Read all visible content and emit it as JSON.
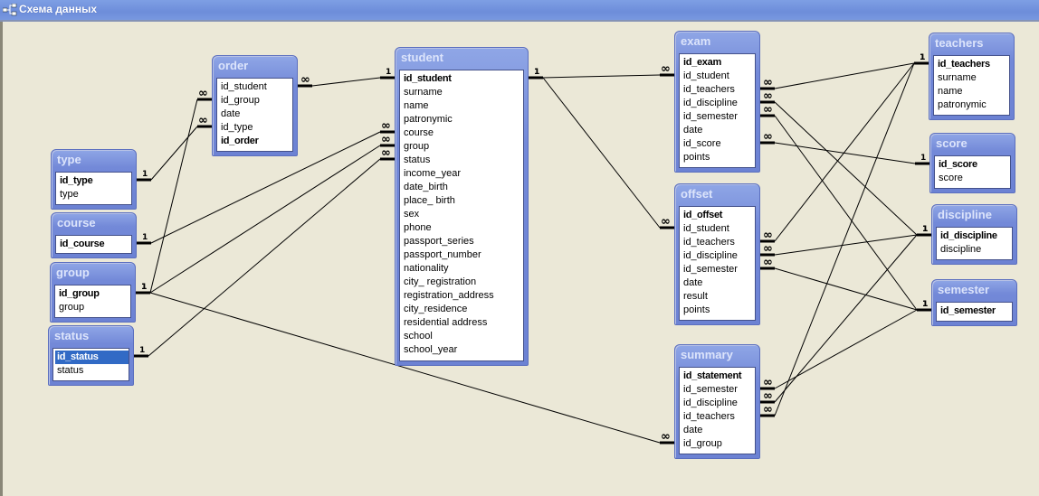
{
  "window": {
    "title": "Схема данных",
    "icon": "relationships-icon"
  },
  "tables": {
    "type": {
      "name": "type",
      "fields": [
        {
          "label": "id_type",
          "key": true
        },
        {
          "label": "type"
        }
      ]
    },
    "course": {
      "name": "course",
      "fields": [
        {
          "label": "id_course",
          "key": true
        }
      ]
    },
    "group": {
      "name": "group",
      "fields": [
        {
          "label": "id_group",
          "key": true
        },
        {
          "label": "group"
        }
      ]
    },
    "status": {
      "name": "status",
      "fields": [
        {
          "label": "id_status",
          "key": true,
          "selected": true
        },
        {
          "label": "status"
        }
      ]
    },
    "order": {
      "name": "order",
      "fields": [
        {
          "label": "id_student"
        },
        {
          "label": "id_group"
        },
        {
          "label": "date"
        },
        {
          "label": "id_type"
        },
        {
          "label": "id_order",
          "key": true
        }
      ]
    },
    "student": {
      "name": "student",
      "fields": [
        {
          "label": "id_student",
          "key": true
        },
        {
          "label": "surname"
        },
        {
          "label": "name"
        },
        {
          "label": "patronymic"
        },
        {
          "label": "course"
        },
        {
          "label": "group"
        },
        {
          "label": "status"
        },
        {
          "label": "income_year"
        },
        {
          "label": "date_birth"
        },
        {
          "label": "place_ birth"
        },
        {
          "label": "sex"
        },
        {
          "label": "phone"
        },
        {
          "label": "passport_series"
        },
        {
          "label": "passport_number"
        },
        {
          "label": "nationality"
        },
        {
          "label": "city_ registration"
        },
        {
          "label": "registration_address"
        },
        {
          "label": "city_residence"
        },
        {
          "label": "residential address"
        },
        {
          "label": "school"
        },
        {
          "label": "school_year"
        }
      ]
    },
    "exam": {
      "name": "exam",
      "fields": [
        {
          "label": "id_exam",
          "key": true
        },
        {
          "label": "id_student"
        },
        {
          "label": "id_teachers"
        },
        {
          "label": "id_discipline"
        },
        {
          "label": "id_semester"
        },
        {
          "label": "date"
        },
        {
          "label": "id_score"
        },
        {
          "label": "points"
        }
      ]
    },
    "offset": {
      "name": "offset",
      "fields": [
        {
          "label": "id_offset",
          "key": true
        },
        {
          "label": "id_student"
        },
        {
          "label": "id_teachers"
        },
        {
          "label": "id_discipline"
        },
        {
          "label": "id_semester"
        },
        {
          "label": "date"
        },
        {
          "label": "result"
        },
        {
          "label": "points"
        }
      ]
    },
    "summary": {
      "name": "summary",
      "fields": [
        {
          "label": "id_statement",
          "key": true
        },
        {
          "label": "id_semester"
        },
        {
          "label": "id_discipline"
        },
        {
          "label": "id_teachers"
        },
        {
          "label": "date"
        },
        {
          "label": "id_group"
        }
      ]
    },
    "teachers": {
      "name": "teachers",
      "fields": [
        {
          "label": "id_teachers",
          "key": true
        },
        {
          "label": "surname"
        },
        {
          "label": "name"
        },
        {
          "label": "patronymic"
        }
      ]
    },
    "score": {
      "name": "score",
      "fields": [
        {
          "label": "id_score",
          "key": true
        },
        {
          "label": "score"
        }
      ]
    },
    "discipline": {
      "name": "discipline",
      "fields": [
        {
          "label": "id_discipline",
          "key": true
        },
        {
          "label": "discipline"
        }
      ]
    },
    "semester": {
      "name": "semester",
      "fields": [
        {
          "label": "id_semester",
          "key": true
        }
      ]
    }
  },
  "relationships": [
    {
      "one": "student.id_student",
      "many": "order.id_student"
    },
    {
      "one": "student.id_student",
      "many": "exam.id_student"
    },
    {
      "one": "student.id_student",
      "many": "offset.id_student"
    },
    {
      "one": "type.id_type",
      "many": "order.id_type"
    },
    {
      "one": "group.id_group",
      "many": "order.id_group"
    },
    {
      "one": "course.id_course",
      "many": "student.course"
    },
    {
      "one": "group.id_group",
      "many": "student.group"
    },
    {
      "one": "status.id_status",
      "many": "student.status"
    },
    {
      "one": "group.id_group",
      "many": "summary.id_group"
    },
    {
      "one": "teachers.id_teachers",
      "many": "exam.id_teachers"
    },
    {
      "one": "discipline.id_discipline",
      "many": "exam.id_discipline"
    },
    {
      "one": "semester.id_semester",
      "many": "exam.id_semester"
    },
    {
      "one": "score.id_score",
      "many": "exam.id_score"
    },
    {
      "one": "teachers.id_teachers",
      "many": "offset.id_teachers"
    },
    {
      "one": "discipline.id_discipline",
      "many": "offset.id_discipline"
    },
    {
      "one": "semester.id_semester",
      "many": "offset.id_semester"
    },
    {
      "one": "semester.id_semester",
      "many": "summary.id_semester"
    },
    {
      "one": "discipline.id_discipline",
      "many": "summary.id_discipline"
    },
    {
      "one": "teachers.id_teachers",
      "many": "summary.id_teachers"
    }
  ],
  "cardinality": {
    "one": "1",
    "many": "∞"
  }
}
